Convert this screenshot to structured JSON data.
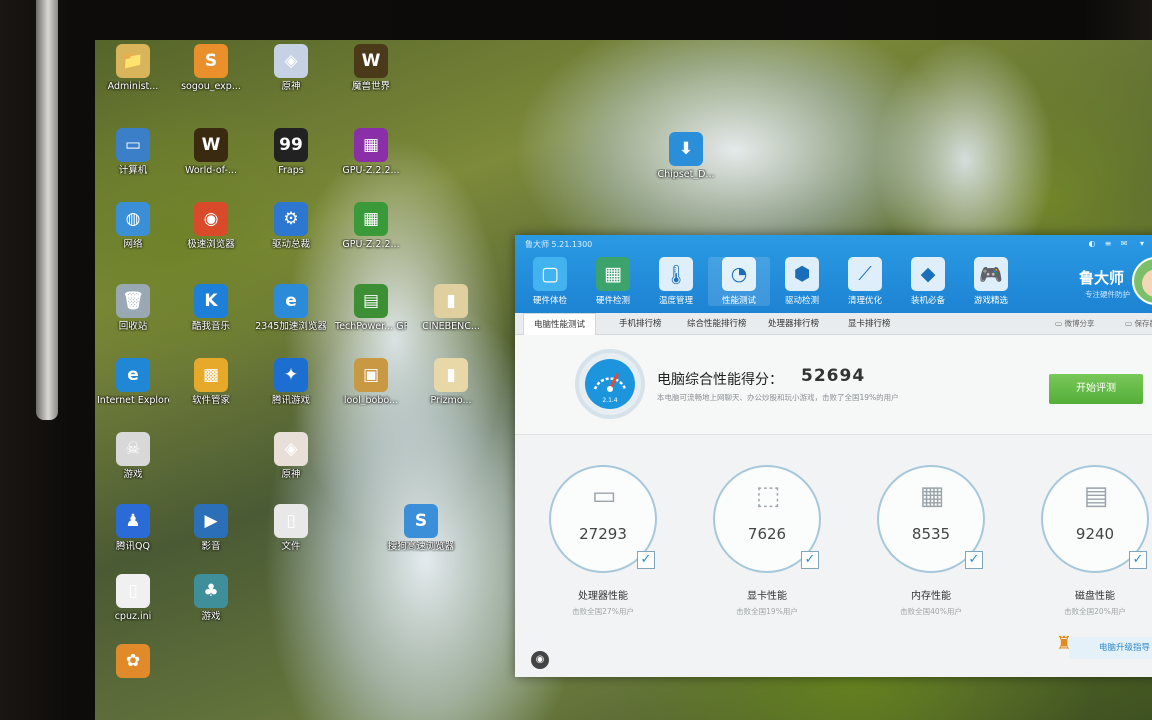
{
  "desktop": {
    "icons": [
      {
        "label": "Administ...",
        "glyph": "📁",
        "color": "#d8b45a"
      },
      {
        "label": "sogou_exp...",
        "glyph": "S",
        "color": "#e9902c"
      },
      {
        "label": "原神",
        "glyph": "◈",
        "color": "#c6d2e4"
      },
      {
        "label": "魔兽世界",
        "glyph": "W",
        "color": "#4a3a1a"
      },
      {
        "label": "计算机",
        "glyph": "▭",
        "color": "#3a7fc8"
      },
      {
        "label": "World-of-...",
        "glyph": "W",
        "color": "#3a2a10"
      },
      {
        "label": "Fraps",
        "glyph": "99",
        "color": "#222222"
      },
      {
        "label": "GPU-Z.2.2...",
        "glyph": "▦",
        "color": "#8b2fa8"
      },
      {
        "label": "网络",
        "glyph": "◍",
        "color": "#3b8fd6"
      },
      {
        "label": "极速浏览器",
        "glyph": "◉",
        "color": "#d84a2a"
      },
      {
        "label": "驱动总裁",
        "glyph": "⚙",
        "color": "#2d77d0"
      },
      {
        "label": "GPU-Z.2.2...",
        "glyph": "▦",
        "color": "#3a9a3a"
      },
      {
        "label": "回收站",
        "glyph": "🗑",
        "color": "#9aa8b4"
      },
      {
        "label": "酷我音乐",
        "glyph": "K",
        "color": "#1e7fd8"
      },
      {
        "label": "2345加速浏览器",
        "glyph": "e",
        "color": "#2b8bd8"
      },
      {
        "label": "TechPower... GPU-Z",
        "glyph": "▤",
        "color": "#3d8f35"
      },
      {
        "label": "CINEBENC...",
        "glyph": "▮",
        "color": "#e0d0a0"
      },
      {
        "label": "Internet Explorer",
        "glyph": "e",
        "color": "#1f87d6"
      },
      {
        "label": "软件管家",
        "glyph": "▩",
        "color": "#e7a92a"
      },
      {
        "label": "腾讯游戏",
        "glyph": "✦",
        "color": "#1c6fd1"
      },
      {
        "label": "lool_bobo...",
        "glyph": "▣",
        "color": "#c99842"
      },
      {
        "label": "Prizmo...",
        "glyph": "▮",
        "color": "#e8d8a8"
      },
      {
        "label": "游戏",
        "glyph": "☠",
        "color": "#d8d8d8"
      },
      {
        "label": "原神",
        "glyph": "◈",
        "color": "#e8e0d8"
      },
      {
        "label": "腾讯QQ",
        "glyph": "♟",
        "color": "#2a6bd8"
      },
      {
        "label": "影音",
        "glyph": "▶",
        "color": "#2b6fb8"
      },
      {
        "label": "文件",
        "glyph": "▯",
        "color": "#e8e8e8"
      },
      {
        "label": "搜狗高速浏览器",
        "glyph": "S",
        "color": "#3a8fd8"
      },
      {
        "label": "cpuz.ini",
        "glyph": "▯",
        "color": "#f0f0f0"
      },
      {
        "label": "游戏",
        "glyph": "♣",
        "color": "#3f8f9a"
      },
      {
        "label": "",
        "glyph": "✿",
        "color": "#e08a2a"
      },
      {
        "label": "Chipset_D...",
        "glyph": "⬇",
        "color": "#2a8fd8"
      }
    ]
  },
  "app": {
    "title": "鲁大师 5.21.1300",
    "modules": [
      {
        "label": "硬件体检",
        "icon": "display-drop-icon"
      },
      {
        "label": "硬件检测",
        "icon": "chip-board-icon"
      },
      {
        "label": "温度管理",
        "icon": "thermometer-icon"
      },
      {
        "label": "性能测试",
        "icon": "speedometer-icon"
      },
      {
        "label": "驱动检测",
        "icon": "gear-box-icon"
      },
      {
        "label": "清理优化",
        "icon": "broom-icon"
      },
      {
        "label": "装机必备",
        "icon": "cube-icon"
      },
      {
        "label": "游戏精选",
        "icon": "gamepad-icon"
      }
    ],
    "brand": {
      "name": "鲁大师",
      "slogan": "专注硬件防护"
    },
    "tabs": [
      "电脑性能测试",
      "手机排行榜",
      "综合性能排行榜",
      "处理器排行榜",
      "显卡排行榜"
    ],
    "tab_tools": {
      "share": "微博分享",
      "save": "保存截图"
    },
    "summary": {
      "label": "电脑综合性能得分：",
      "score": "52694",
      "sub": "本电脑可流畅地上网聊天、办公炒股和玩小游戏，击败了全国19%的用户",
      "gauge_text": "2.1.4",
      "start_button": "开始评测"
    },
    "components": [
      {
        "name": "处理器性能",
        "score": "27293",
        "sub": "击败全国27%用户",
        "icon": "monitor-icon"
      },
      {
        "name": "显卡性能",
        "score": "7626",
        "sub": "击败全国19%用户",
        "icon": "gpu-box-icon"
      },
      {
        "name": "内存性能",
        "score": "8535",
        "sub": "击败全国40%用户",
        "icon": "memory-icon"
      },
      {
        "name": "磁盘性能",
        "score": "9240",
        "sub": "击败全国20%用户",
        "icon": "disk-icon"
      }
    ],
    "upgrade_link": "电脑升级指导"
  }
}
